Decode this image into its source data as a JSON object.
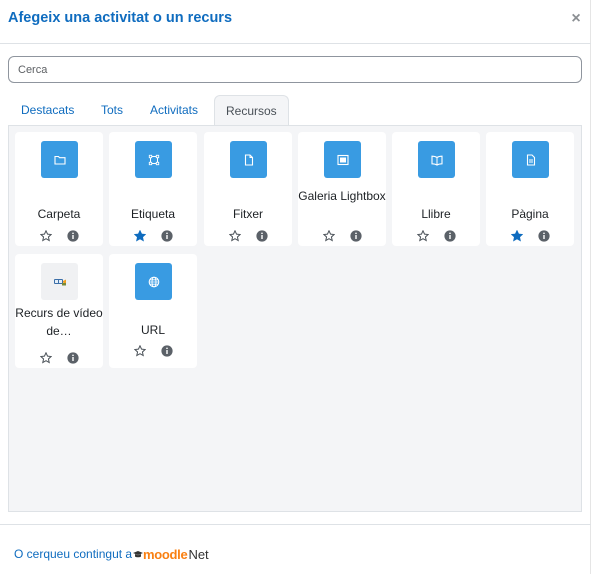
{
  "header": {
    "title": "Afegeix una activitat o un recurs",
    "close_label": "×"
  },
  "search": {
    "placeholder": "Cerca"
  },
  "tabs": [
    {
      "label": "Destacats",
      "active": false
    },
    {
      "label": "Tots",
      "active": false
    },
    {
      "label": "Activitats",
      "active": false
    },
    {
      "label": "Recursos",
      "active": true
    }
  ],
  "resources": [
    {
      "name": "Carpeta",
      "icon": "folder-icon",
      "starred": false
    },
    {
      "name": "Etiqueta",
      "icon": "label-icon",
      "starred": true
    },
    {
      "name": "Fitxer",
      "icon": "file-icon",
      "starred": false
    },
    {
      "name": "Galeria Lightbox",
      "icon": "gallery-icon",
      "starred": false
    },
    {
      "name": "Llibre",
      "icon": "book-icon",
      "starred": false
    },
    {
      "name": "Pàgina",
      "icon": "page-icon",
      "starred": true
    },
    {
      "name": "Recurs de vídeo de…",
      "icon": "video-resource-icon",
      "starred": false
    },
    {
      "name": "URL",
      "icon": "url-globe-icon",
      "starred": false
    }
  ],
  "footer": {
    "link_text": "O cerqueu contingut a",
    "logo_moodle": "moodle",
    "logo_net": "Net"
  },
  "colors": {
    "accent": "#0f6cbf",
    "icon_bg": "#399be2",
    "star_filled": "#0f6cbf",
    "moodle_orange": "#f98012"
  }
}
